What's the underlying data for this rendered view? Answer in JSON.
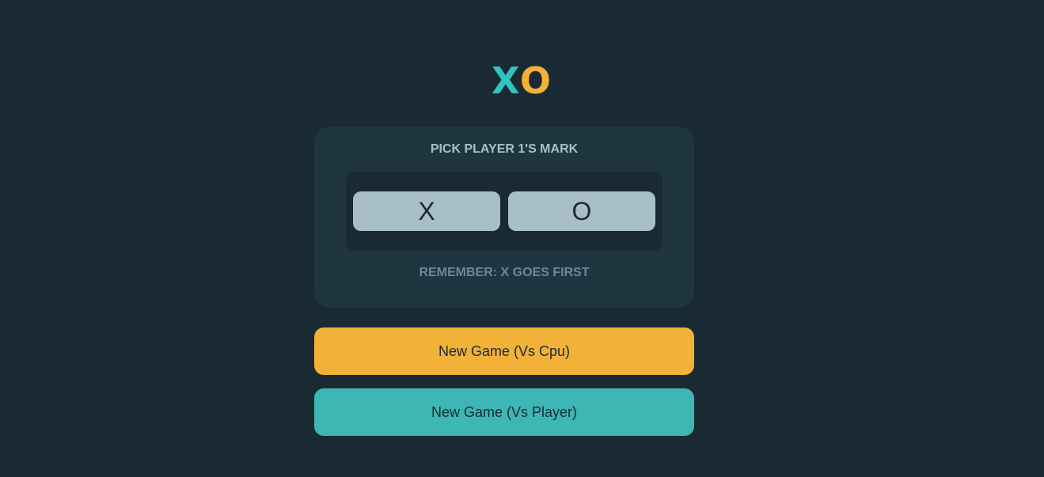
{
  "logo": {
    "x": "X",
    "o": "O"
  },
  "picker": {
    "title": "PICK PLAYER 1'S MARK",
    "x_label": "X",
    "o_label": "O",
    "reminder": "REMEMBER: X GOES FIRST"
  },
  "actions": {
    "vs_cpu": "New Game (Vs Cpu)",
    "vs_player": "New Game (Vs Player)"
  },
  "colors": {
    "background": "#1a2a33",
    "panel": "#1f3641",
    "accent_teal": "#31c3bd",
    "accent_yellow": "#f2b137",
    "silver": "#a8bfc9"
  }
}
